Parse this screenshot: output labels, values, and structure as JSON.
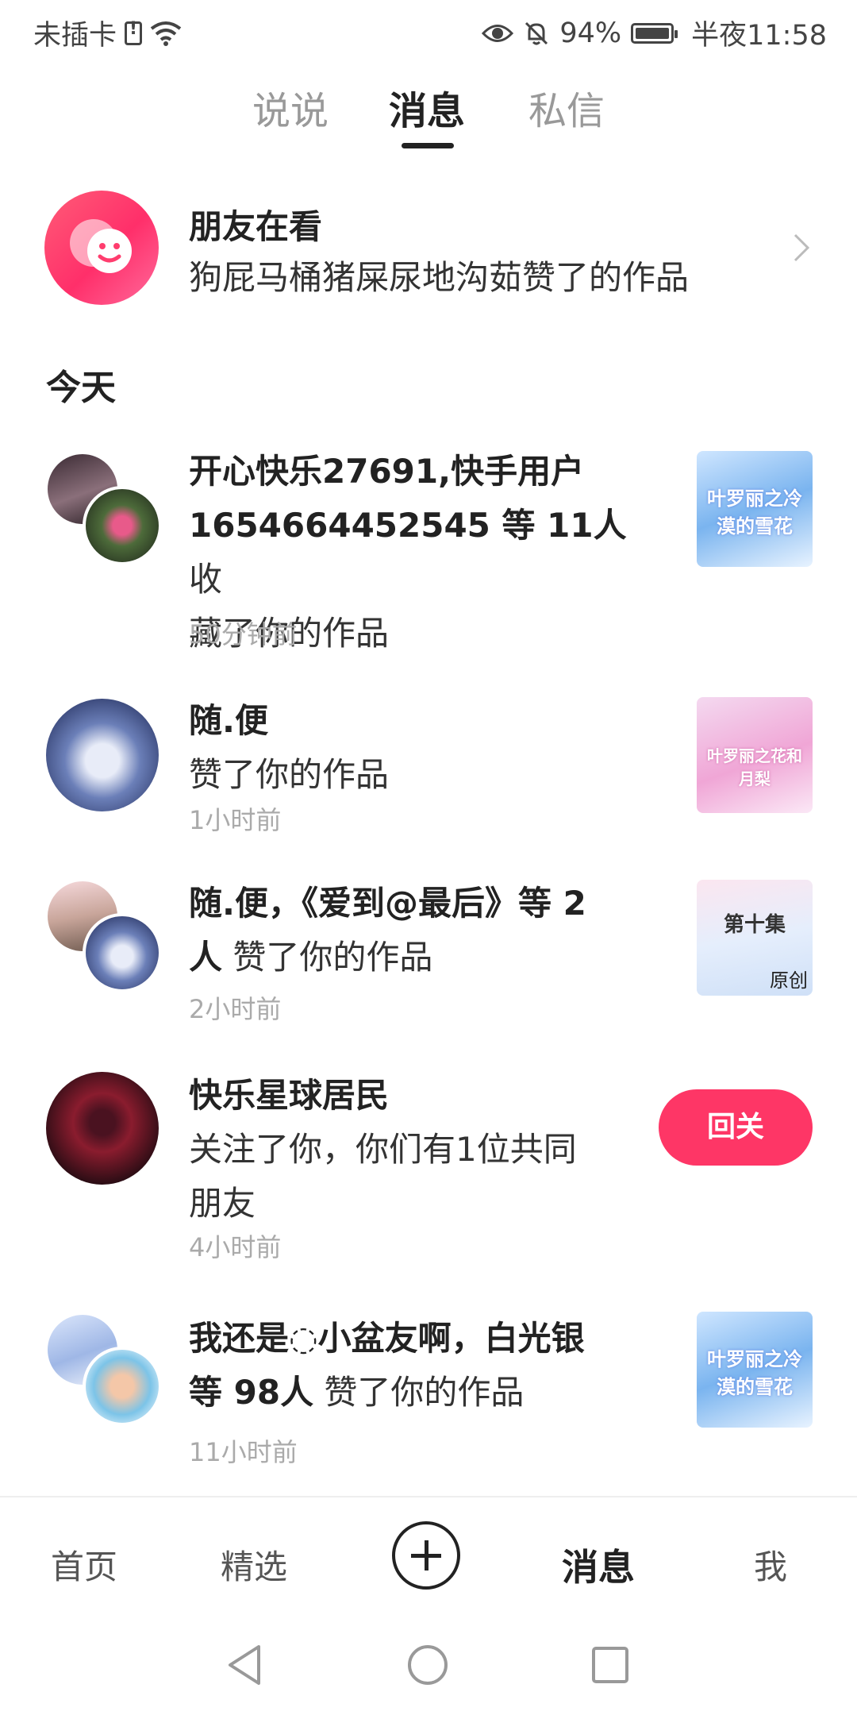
{
  "status_bar": {
    "carrier": "未插卡",
    "battery": "94%",
    "time": "半夜11:58",
    "battery_level": 0.94
  },
  "tabs": [
    {
      "label": "说说",
      "active": false
    },
    {
      "label": "消息",
      "active": true
    },
    {
      "label": "私信",
      "active": false
    }
  ],
  "friends": {
    "title": "朋友在看",
    "subtitle": "狗屁马桶猪屎尿地沟茹赞了的作品"
  },
  "section_title": "今天",
  "notifications": [
    {
      "names": "开心快乐27691,快手用户",
      "names2": "1654664452545 等 11人",
      "action": " 收",
      "action2": "藏了你的作品",
      "time": "50分钟前",
      "thumb_text": "叶罗丽之冷漠的雪花"
    },
    {
      "names": "随.便",
      "action": "赞了你的作品",
      "time": "1小时前",
      "thumb_text": "叶罗丽之花和月梨"
    },
    {
      "names": "随.便，《爱到@最后》等 2",
      "names2": "人",
      "action": " 赞了你的作品",
      "time": "2小时前",
      "thumb_text": "第十集",
      "thumb_sub": "原创"
    },
    {
      "names": "快乐星球居民",
      "action": "关注了你，你们有1位共同",
      "action2": "朋友",
      "time": "4小时前",
      "button": "回关"
    },
    {
      "names": "我还是◌小盆友啊，白光银",
      "names2": "等 98人",
      "action": " 赞了你的作品",
      "time": "11小时前",
      "thumb_text": "叶罗丽之冷漠的雪花"
    }
  ],
  "bottom_nav": [
    {
      "label": "首页",
      "active": false
    },
    {
      "label": "精选",
      "active": false
    },
    {
      "label": "消息",
      "active": true
    },
    {
      "label": "我",
      "active": false
    }
  ],
  "colors": {
    "accent": "#fe3666",
    "text": "#222222",
    "muted": "#aaaaaa"
  }
}
